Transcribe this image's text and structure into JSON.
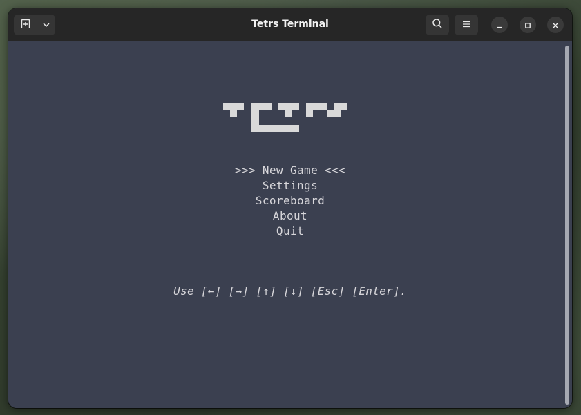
{
  "window": {
    "title": "Tetrs Terminal",
    "icons": {
      "new_tab": "new-tab-icon",
      "dropdown": "chevron-down-icon",
      "search": "search-icon",
      "menu": "hamburger-menu-icon",
      "minimize": "minimize-icon",
      "maximize": "maximize-icon",
      "close": "close-icon"
    }
  },
  "terminal": {
    "logo": "TETRS",
    "menu": [
      ">>> New Game <<<",
      "Settings",
      "Scoreboard",
      "About",
      "Quit"
    ],
    "selected_index": 0,
    "hint": "Use [←] [→] [↑] [↓] [Esc] [Enter]."
  },
  "colors": {
    "terminal_bg": "#3b4050",
    "text": "#d7d6da",
    "logo": "#d9d9d9",
    "headerbar": "#262626"
  }
}
